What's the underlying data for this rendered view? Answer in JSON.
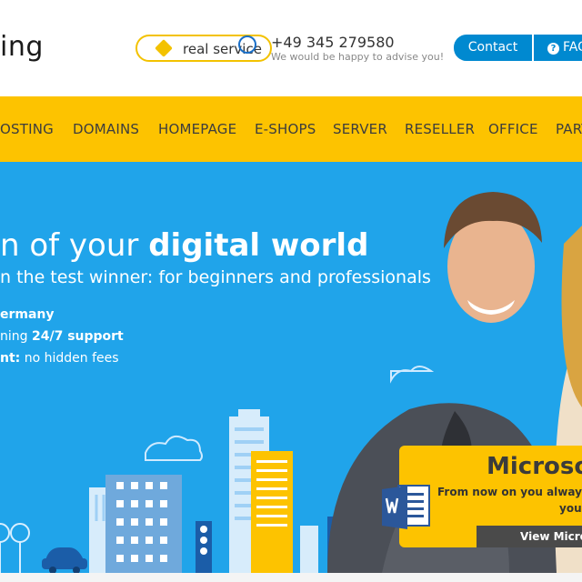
{
  "header": {
    "logo_text": "ing",
    "badge_text": "real service",
    "phone": "+49 345 279580",
    "advise": "We would be happy to advise you!",
    "contact_label": "Contact",
    "faq_label": "FAQ"
  },
  "nav": {
    "items": [
      "OSTING",
      "DOMAINS",
      "HOMEPAGE",
      "E-SHOPS",
      "SERVER",
      "RESELLER",
      "OFFICE",
      "PART"
    ]
  },
  "hero": {
    "heading_pre": "n of your ",
    "heading_bold": "digital world",
    "subheading": "n the test winner: for beginners and professionals",
    "feature1": "ermany",
    "feature2_pre": "ning ",
    "feature2_bold": "24/7 support",
    "feature3_bold": "nt:",
    "feature3_rest": " no hidden fees"
  },
  "promo": {
    "title": "Microso",
    "line1": "From now on you always",
    "line2": "you",
    "button_label": "View Micros"
  },
  "colors": {
    "brand_yellow": "#fdc300",
    "brand_blue": "#0089d0",
    "hero_blue": "#20a4ea"
  }
}
